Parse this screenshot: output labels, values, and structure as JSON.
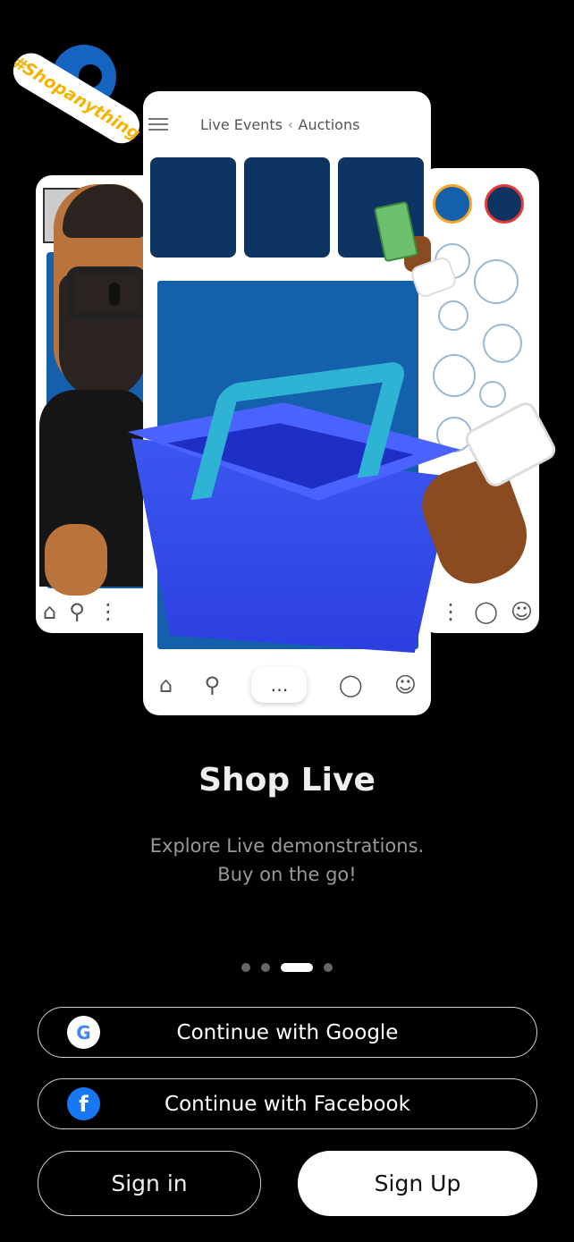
{
  "hero": {
    "tag_text": "#Shopanything",
    "main_card": {
      "tab_live_events": "Live Events",
      "tab_separator": "‹",
      "tab_auctions": "Auctions"
    }
  },
  "onboarding": {
    "title": "Shop Live",
    "subtitle_line1": "Explore Live demonstrations.",
    "subtitle_line2": "Buy on the go!",
    "pager": {
      "total": 4,
      "active_index": 2
    }
  },
  "auth": {
    "google_label": "Continue with Google",
    "google_icon_glyph": "G",
    "facebook_label": "Continue with Facebook",
    "facebook_icon_glyph": "f",
    "signin_label": "Sign in",
    "signup_label": "Sign Up"
  },
  "colors": {
    "background": "#000000",
    "brand_blue": "#1560ad",
    "tile_navy": "#0d3462",
    "tag_yellow": "#f5b300",
    "basket_blue": "#3b57f0",
    "facebook_blue": "#1877f2"
  },
  "icons": [
    "home-icon",
    "search-icon",
    "game-controller-icon",
    "loading-ring-icon",
    "profile-icon",
    "menu-icon",
    "google-icon",
    "facebook-icon"
  ]
}
